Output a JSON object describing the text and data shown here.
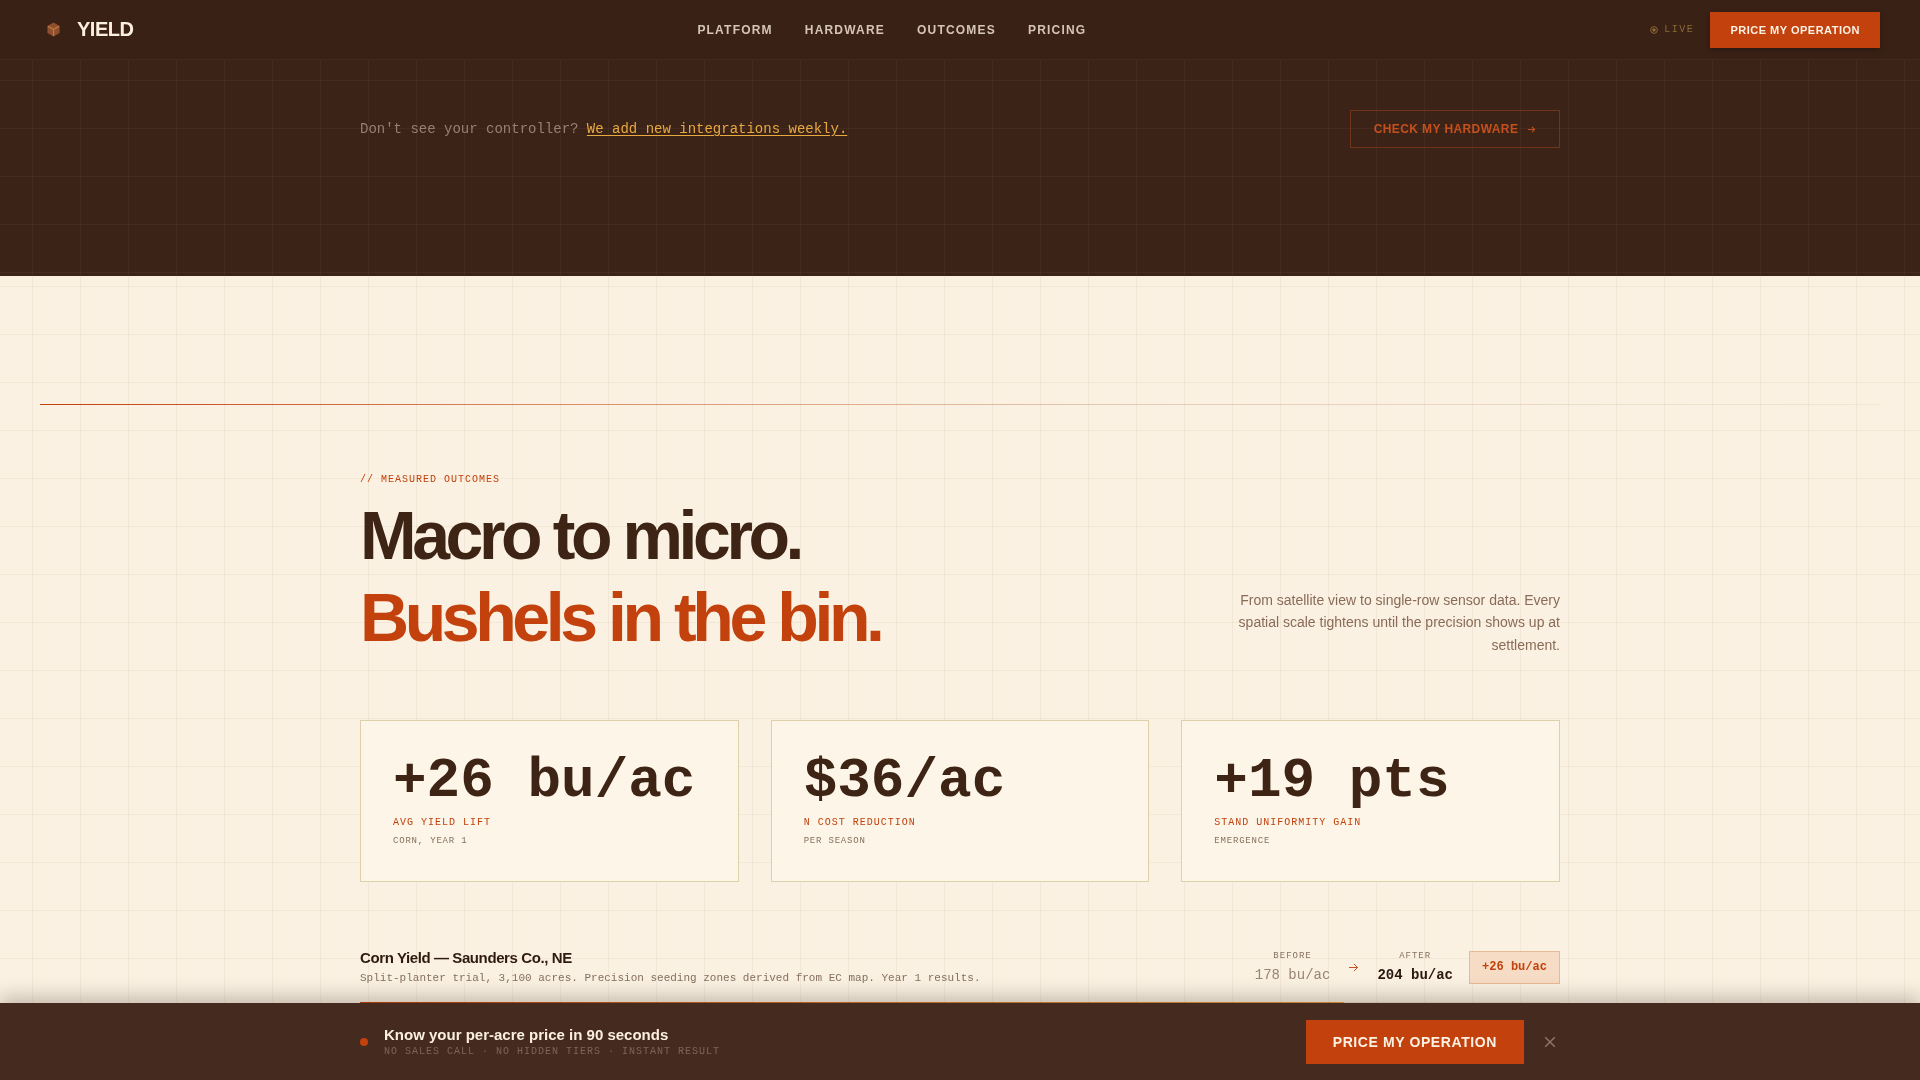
{
  "nav": {
    "brand": "YIELD",
    "links": [
      "PLATFORM",
      "HARDWARE",
      "OUTCOMES",
      "PRICING"
    ],
    "status": "LIVE",
    "cta": "PRICE MY OPERATION"
  },
  "banner": {
    "prompt": "Don't see your controller?",
    "link": "We add new integrations weekly.",
    "button": "CHECK MY HARDWARE"
  },
  "outcomes": {
    "eyebrow": "// MEASURED OUTCOMES",
    "headline": "Macro to micro.",
    "headline_accent": "Bushels in the bin.",
    "description": "From satellite view to single-row sensor data. Every spatial scale tightens until the precision shows up at settlement.",
    "stats": [
      {
        "value": "+26 bu/ac",
        "label": "AVG YIELD LIFT",
        "note": "CORN, YEAR 1"
      },
      {
        "value": "$36/ac",
        "label": "N COST REDUCTION",
        "note": "PER SEASON"
      },
      {
        "value": "+19 pts",
        "label": "STAND UNIFORMITY GAIN",
        "note": "EMERGENCE"
      }
    ],
    "case_study": {
      "title": "Corn Yield — Saunders Co., NE",
      "description": "Split-planter trial, 3,100 acres. Precision seeding zones derived from EC map. Year 1 results.",
      "before_label": "BEFORE",
      "before": "178 bu/ac",
      "after_label": "AFTER",
      "after": "204 bu/ac",
      "delta": "+26 bu/ac",
      "level": 0.82
    }
  },
  "sticky_bar": {
    "title": "Know your per-acre price in 90 seconds",
    "subtitle": "NO SALES CALL · NO HIDDEN TIERS · INSTANT RESULT",
    "button": "PRICE MY OPERATION"
  }
}
